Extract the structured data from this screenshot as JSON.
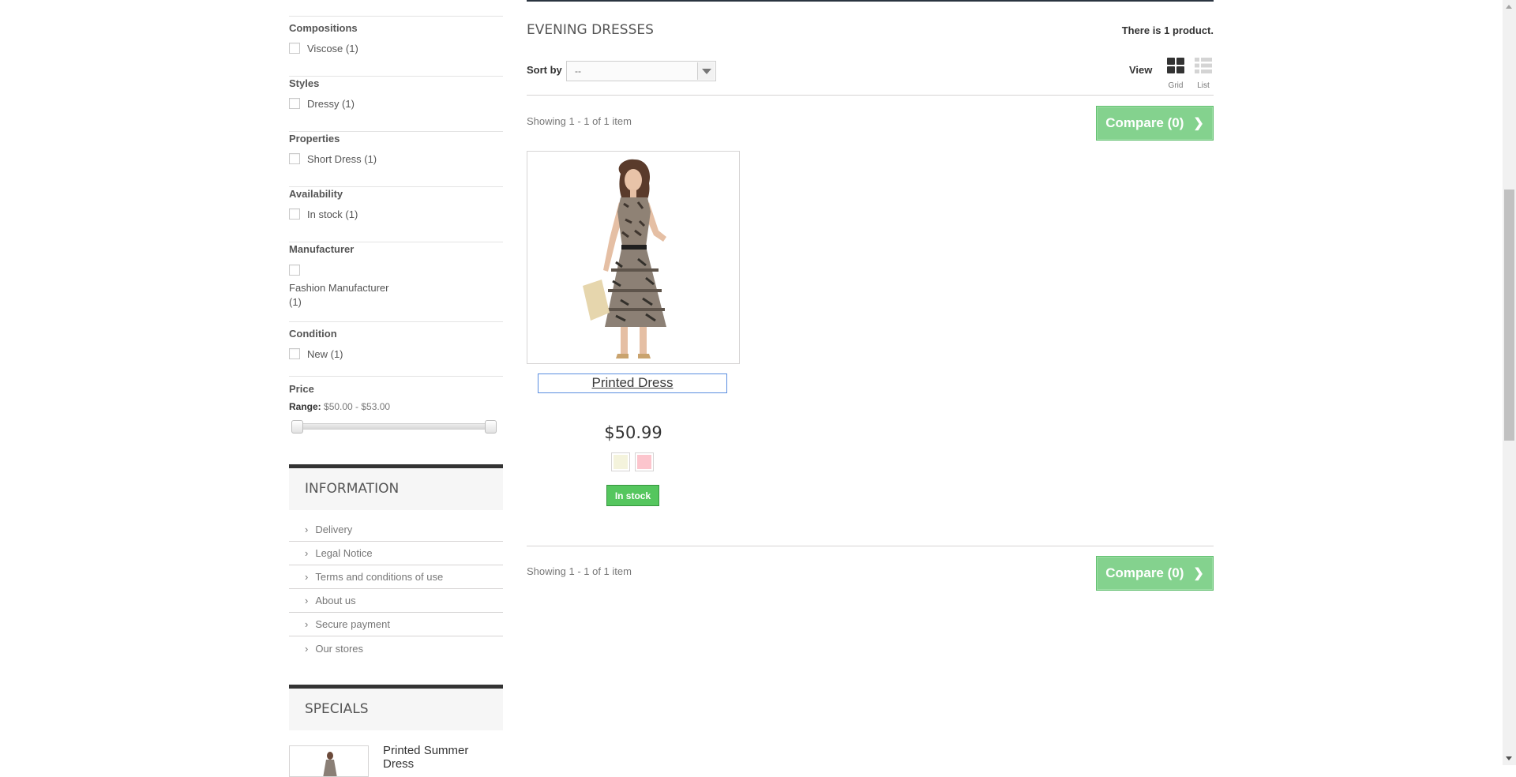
{
  "filters": [
    {
      "title": "Compositions",
      "options": [
        {
          "label": "Viscose (1)"
        }
      ]
    },
    {
      "title": "Styles",
      "options": [
        {
          "label": "Dressy (1)"
        }
      ]
    },
    {
      "title": "Properties",
      "options": [
        {
          "label": "Short Dress (1)"
        }
      ]
    },
    {
      "title": "Availability",
      "options": [
        {
          "label": "In stock (1)"
        }
      ]
    },
    {
      "title": "Manufacturer",
      "options": [
        {
          "label": "Fashion Manufacturer (1)"
        }
      ]
    },
    {
      "title": "Condition",
      "options": [
        {
          "label": "New (1)"
        }
      ]
    }
  ],
  "price_filter": {
    "title": "Price",
    "range_label": "Range:",
    "range_value": "$50.00 - $53.00"
  },
  "information": {
    "title": "INFORMATION",
    "items": [
      "Delivery",
      "Legal Notice",
      "Terms and conditions of use",
      "About us",
      "Secure payment",
      "Our stores"
    ]
  },
  "specials": {
    "title": "SPECIALS",
    "item_name": "Printed Summer Dress"
  },
  "category": {
    "title": "EVENING DRESSES",
    "count_text": "There is 1 product."
  },
  "toolbar": {
    "sort_label": "Sort by",
    "sort_value": "--",
    "view_label": "View",
    "grid_label": "Grid",
    "list_label": "List"
  },
  "pagination": {
    "showing_top": "Showing 1 - 1 of 1 item",
    "showing_bottom": "Showing 1 - 1 of 1 item",
    "compare_label": "Compare (0)"
  },
  "product": {
    "name": "Printed Dress",
    "price": "$50.99",
    "availability": "In stock",
    "swatch_colors": [
      "#f4f3dc",
      "#fcc5cd"
    ]
  },
  "icons": {
    "chevron_right": "›",
    "compare_chevron": "❯"
  }
}
